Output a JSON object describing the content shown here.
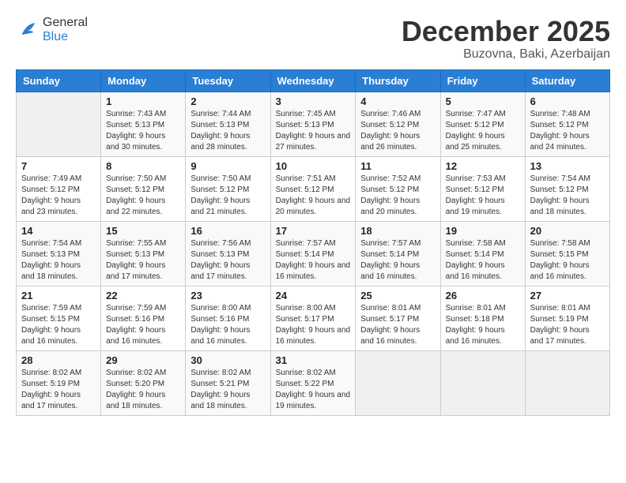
{
  "header": {
    "logo_general": "General",
    "logo_blue": "Blue",
    "month_title": "December 2025",
    "subtitle": "Buzovna, Baki, Azerbaijan"
  },
  "days_of_week": [
    "Sunday",
    "Monday",
    "Tuesday",
    "Wednesday",
    "Thursday",
    "Friday",
    "Saturday"
  ],
  "weeks": [
    [
      {
        "day": "",
        "sunrise": "",
        "sunset": "",
        "daylight": ""
      },
      {
        "day": "1",
        "sunrise": "Sunrise: 7:43 AM",
        "sunset": "Sunset: 5:13 PM",
        "daylight": "Daylight: 9 hours and 30 minutes."
      },
      {
        "day": "2",
        "sunrise": "Sunrise: 7:44 AM",
        "sunset": "Sunset: 5:13 PM",
        "daylight": "Daylight: 9 hours and 28 minutes."
      },
      {
        "day": "3",
        "sunrise": "Sunrise: 7:45 AM",
        "sunset": "Sunset: 5:13 PM",
        "daylight": "Daylight: 9 hours and 27 minutes."
      },
      {
        "day": "4",
        "sunrise": "Sunrise: 7:46 AM",
        "sunset": "Sunset: 5:12 PM",
        "daylight": "Daylight: 9 hours and 26 minutes."
      },
      {
        "day": "5",
        "sunrise": "Sunrise: 7:47 AM",
        "sunset": "Sunset: 5:12 PM",
        "daylight": "Daylight: 9 hours and 25 minutes."
      },
      {
        "day": "6",
        "sunrise": "Sunrise: 7:48 AM",
        "sunset": "Sunset: 5:12 PM",
        "daylight": "Daylight: 9 hours and 24 minutes."
      }
    ],
    [
      {
        "day": "7",
        "sunrise": "Sunrise: 7:49 AM",
        "sunset": "Sunset: 5:12 PM",
        "daylight": "Daylight: 9 hours and 23 minutes."
      },
      {
        "day": "8",
        "sunrise": "Sunrise: 7:50 AM",
        "sunset": "Sunset: 5:12 PM",
        "daylight": "Daylight: 9 hours and 22 minutes."
      },
      {
        "day": "9",
        "sunrise": "Sunrise: 7:50 AM",
        "sunset": "Sunset: 5:12 PM",
        "daylight": "Daylight: 9 hours and 21 minutes."
      },
      {
        "day": "10",
        "sunrise": "Sunrise: 7:51 AM",
        "sunset": "Sunset: 5:12 PM",
        "daylight": "Daylight: 9 hours and 20 minutes."
      },
      {
        "day": "11",
        "sunrise": "Sunrise: 7:52 AM",
        "sunset": "Sunset: 5:12 PM",
        "daylight": "Daylight: 9 hours and 20 minutes."
      },
      {
        "day": "12",
        "sunrise": "Sunrise: 7:53 AM",
        "sunset": "Sunset: 5:12 PM",
        "daylight": "Daylight: 9 hours and 19 minutes."
      },
      {
        "day": "13",
        "sunrise": "Sunrise: 7:54 AM",
        "sunset": "Sunset: 5:12 PM",
        "daylight": "Daylight: 9 hours and 18 minutes."
      }
    ],
    [
      {
        "day": "14",
        "sunrise": "Sunrise: 7:54 AM",
        "sunset": "Sunset: 5:13 PM",
        "daylight": "Daylight: 9 hours and 18 minutes."
      },
      {
        "day": "15",
        "sunrise": "Sunrise: 7:55 AM",
        "sunset": "Sunset: 5:13 PM",
        "daylight": "Daylight: 9 hours and 17 minutes."
      },
      {
        "day": "16",
        "sunrise": "Sunrise: 7:56 AM",
        "sunset": "Sunset: 5:13 PM",
        "daylight": "Daylight: 9 hours and 17 minutes."
      },
      {
        "day": "17",
        "sunrise": "Sunrise: 7:57 AM",
        "sunset": "Sunset: 5:14 PM",
        "daylight": "Daylight: 9 hours and 16 minutes."
      },
      {
        "day": "18",
        "sunrise": "Sunrise: 7:57 AM",
        "sunset": "Sunset: 5:14 PM",
        "daylight": "Daylight: 9 hours and 16 minutes."
      },
      {
        "day": "19",
        "sunrise": "Sunrise: 7:58 AM",
        "sunset": "Sunset: 5:14 PM",
        "daylight": "Daylight: 9 hours and 16 minutes."
      },
      {
        "day": "20",
        "sunrise": "Sunrise: 7:58 AM",
        "sunset": "Sunset: 5:15 PM",
        "daylight": "Daylight: 9 hours and 16 minutes."
      }
    ],
    [
      {
        "day": "21",
        "sunrise": "Sunrise: 7:59 AM",
        "sunset": "Sunset: 5:15 PM",
        "daylight": "Daylight: 9 hours and 16 minutes."
      },
      {
        "day": "22",
        "sunrise": "Sunrise: 7:59 AM",
        "sunset": "Sunset: 5:16 PM",
        "daylight": "Daylight: 9 hours and 16 minutes."
      },
      {
        "day": "23",
        "sunrise": "Sunrise: 8:00 AM",
        "sunset": "Sunset: 5:16 PM",
        "daylight": "Daylight: 9 hours and 16 minutes."
      },
      {
        "day": "24",
        "sunrise": "Sunrise: 8:00 AM",
        "sunset": "Sunset: 5:17 PM",
        "daylight": "Daylight: 9 hours and 16 minutes."
      },
      {
        "day": "25",
        "sunrise": "Sunrise: 8:01 AM",
        "sunset": "Sunset: 5:17 PM",
        "daylight": "Daylight: 9 hours and 16 minutes."
      },
      {
        "day": "26",
        "sunrise": "Sunrise: 8:01 AM",
        "sunset": "Sunset: 5:18 PM",
        "daylight": "Daylight: 9 hours and 16 minutes."
      },
      {
        "day": "27",
        "sunrise": "Sunrise: 8:01 AM",
        "sunset": "Sunset: 5:19 PM",
        "daylight": "Daylight: 9 hours and 17 minutes."
      }
    ],
    [
      {
        "day": "28",
        "sunrise": "Sunrise: 8:02 AM",
        "sunset": "Sunset: 5:19 PM",
        "daylight": "Daylight: 9 hours and 17 minutes."
      },
      {
        "day": "29",
        "sunrise": "Sunrise: 8:02 AM",
        "sunset": "Sunset: 5:20 PM",
        "daylight": "Daylight: 9 hours and 18 minutes."
      },
      {
        "day": "30",
        "sunrise": "Sunrise: 8:02 AM",
        "sunset": "Sunset: 5:21 PM",
        "daylight": "Daylight: 9 hours and 18 minutes."
      },
      {
        "day": "31",
        "sunrise": "Sunrise: 8:02 AM",
        "sunset": "Sunset: 5:22 PM",
        "daylight": "Daylight: 9 hours and 19 minutes."
      },
      {
        "day": "",
        "sunrise": "",
        "sunset": "",
        "daylight": ""
      },
      {
        "day": "",
        "sunrise": "",
        "sunset": "",
        "daylight": ""
      },
      {
        "day": "",
        "sunrise": "",
        "sunset": "",
        "daylight": ""
      }
    ]
  ]
}
